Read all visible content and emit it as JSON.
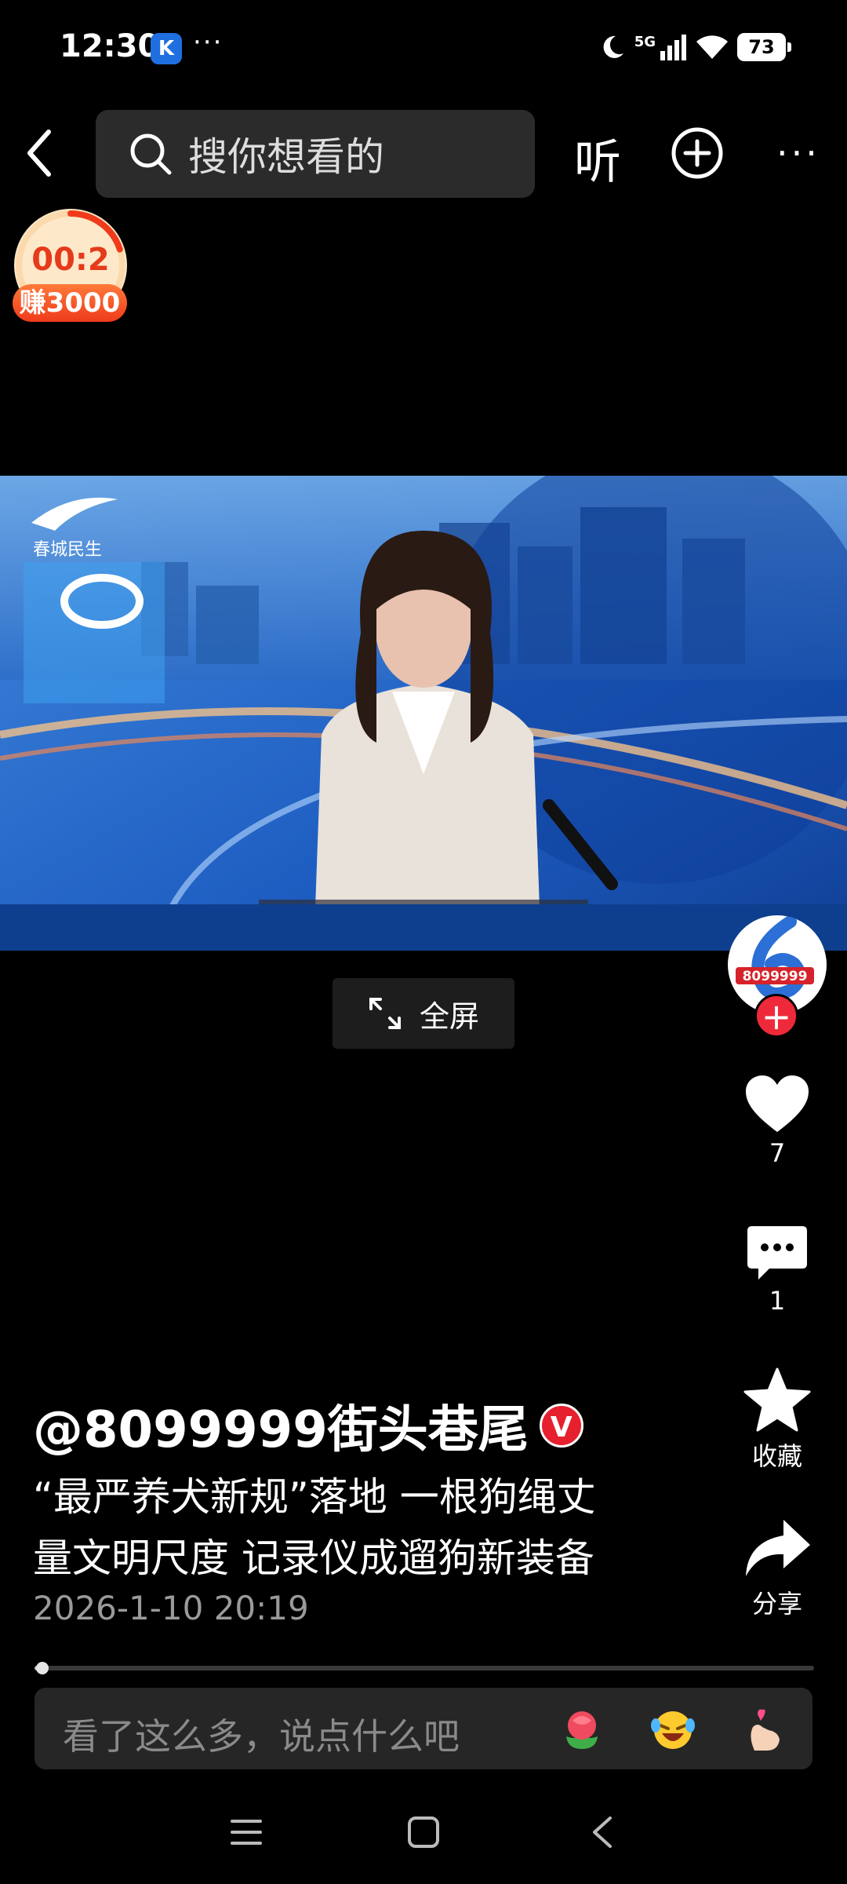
{
  "status_bar": {
    "time": "12:30",
    "app_badge": "K",
    "more": "···",
    "network": "5G",
    "battery": "73"
  },
  "top_bar": {
    "search_placeholder": "搜你想看的",
    "listen_label": "听",
    "more": "···"
  },
  "reward": {
    "timer": "00:2",
    "badge": "赚3000",
    "progress": 0.2
  },
  "video": {
    "channel_logo_text": "春城民生"
  },
  "fullscreen_label": "全屏",
  "right_rail": {
    "avatar_text": "8099999",
    "follow": "+",
    "likes": "7",
    "comments": "1",
    "favorite_label": "收藏",
    "share_label": "分享"
  },
  "post": {
    "author": "@8099999街头巷尾",
    "verified": "V",
    "title_line1": "“最严养犬新规”落地 一根狗绳丈",
    "title_line2": "量文明尺度 记录仪成遛狗新装备",
    "time": "2026-1-10 20:19"
  },
  "playback": {
    "progress": 0.01
  },
  "comment_bar": {
    "placeholder": "看了这么多，说点什么吧"
  },
  "colors": {
    "accent": "#ee2a3a",
    "reward_orange": "#ef3b1b",
    "video_blue": "#1b58b5"
  }
}
